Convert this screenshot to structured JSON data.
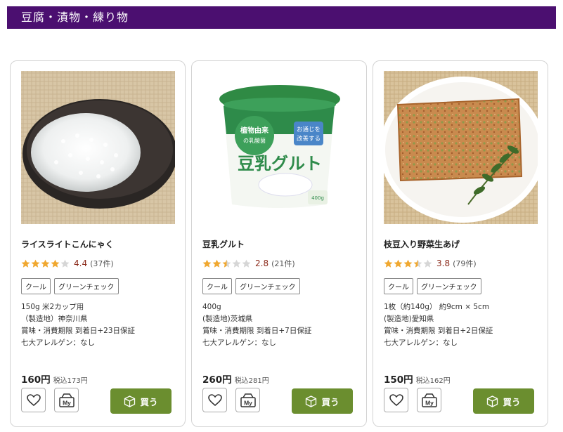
{
  "section": {
    "title": "豆腐・漬物・練り物"
  },
  "products": [
    {
      "name": "ライスライトこんにゃく",
      "stars": 4,
      "score": "4.4",
      "count": "(37件)",
      "tags": [
        "クール",
        "グリーンチェック"
      ],
      "specs": [
        "150g 米2カップ用",
        "（製造地）神奈川県",
        "賞味・消費期限 到着日+23日保証",
        "七大アレルゲン：なし"
      ],
      "price": "160円",
      "tax_price": "税込173円",
      "my_label": "My",
      "buy_label": "買う",
      "image_icon": "rice-konjac-photo"
    },
    {
      "name": "豆乳グルト",
      "stars": 2.5,
      "score": "2.8",
      "count": "(21件)",
      "tags": [
        "クール",
        "グリーンチェック"
      ],
      "specs": [
        "400g",
        "(製造地)茨城県",
        "賞味・消費期限 到着日+7日保証",
        "七大アレルゲン：なし"
      ],
      "price": "260円",
      "tax_price": "税込281円",
      "my_label": "My",
      "buy_label": "買う",
      "package_text": {
        "brand_circle": "植物由来",
        "brand_circle2": "の乳酸菌",
        "badge1": "お通じを",
        "badge2": "改善する",
        "main": "豆乳グルト",
        "volume": "400g"
      },
      "image_icon": "soy-yogurt-photo"
    },
    {
      "name": "枝豆入り野菜生あげ",
      "stars": 3.5,
      "score": "3.8",
      "count": "(79件)",
      "tags": [
        "クール",
        "グリーンチェック"
      ],
      "specs": [
        "1枚（約140g） 約9cm × 5cm",
        "(製造地)愛知県",
        "賞味・消費期限 到着日+2日保証",
        "七大アレルゲン：なし"
      ],
      "price": "150円",
      "tax_price": "税込162円",
      "my_label": "My",
      "buy_label": "買う",
      "image_icon": "fried-tofu-photo"
    }
  ],
  "colors": {
    "banner": "#4b0f70",
    "buy": "#6b8e2f",
    "star": "#f0a830",
    "score": "#8b2a1a"
  }
}
